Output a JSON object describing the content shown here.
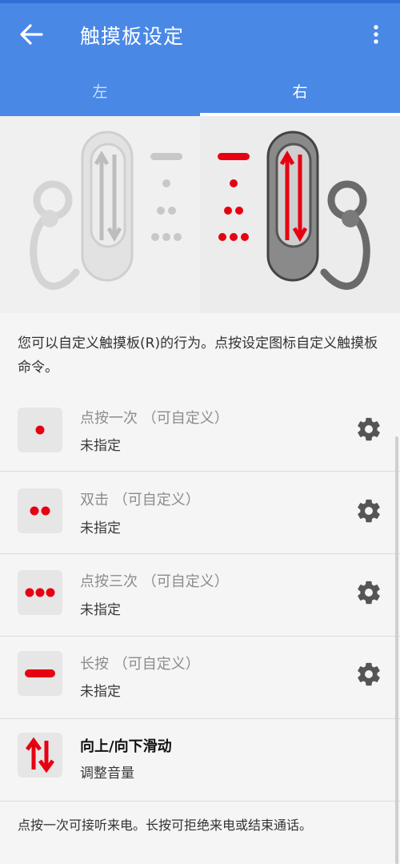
{
  "appbar": {
    "title": "触摸板设定",
    "back_icon": "arrow-left-icon",
    "more_icon": "more-vert-icon",
    "color": "#4a88e6"
  },
  "tabs": [
    {
      "label": "左",
      "selected": false
    },
    {
      "label": "右",
      "selected": true
    }
  ],
  "hero": {
    "accent": "#e60012",
    "inactive": "#c8c8c8"
  },
  "description": "您可以自定义触摸板(R)的行为。点按设定图标自定义触摸板命令。",
  "gestures": [
    {
      "label": "点按一次 （可自定义）",
      "value": "未指定",
      "icon": "single-dot-icon"
    },
    {
      "label": "双击 （可自定义）",
      "value": "未指定",
      "icon": "double-dot-icon"
    },
    {
      "label": "点按三次 （可自定义）",
      "value": "未指定",
      "icon": "triple-dot-icon"
    },
    {
      "label": "长按 （可自定义）",
      "value": "未指定",
      "icon": "long-press-icon"
    }
  ],
  "swipe": {
    "label": "向上/向下滑动",
    "value": "调整音量",
    "icon": "swipe-up-down-icon"
  },
  "footer": "点按一次可接听来电。长按可拒绝来电或结束通话。"
}
